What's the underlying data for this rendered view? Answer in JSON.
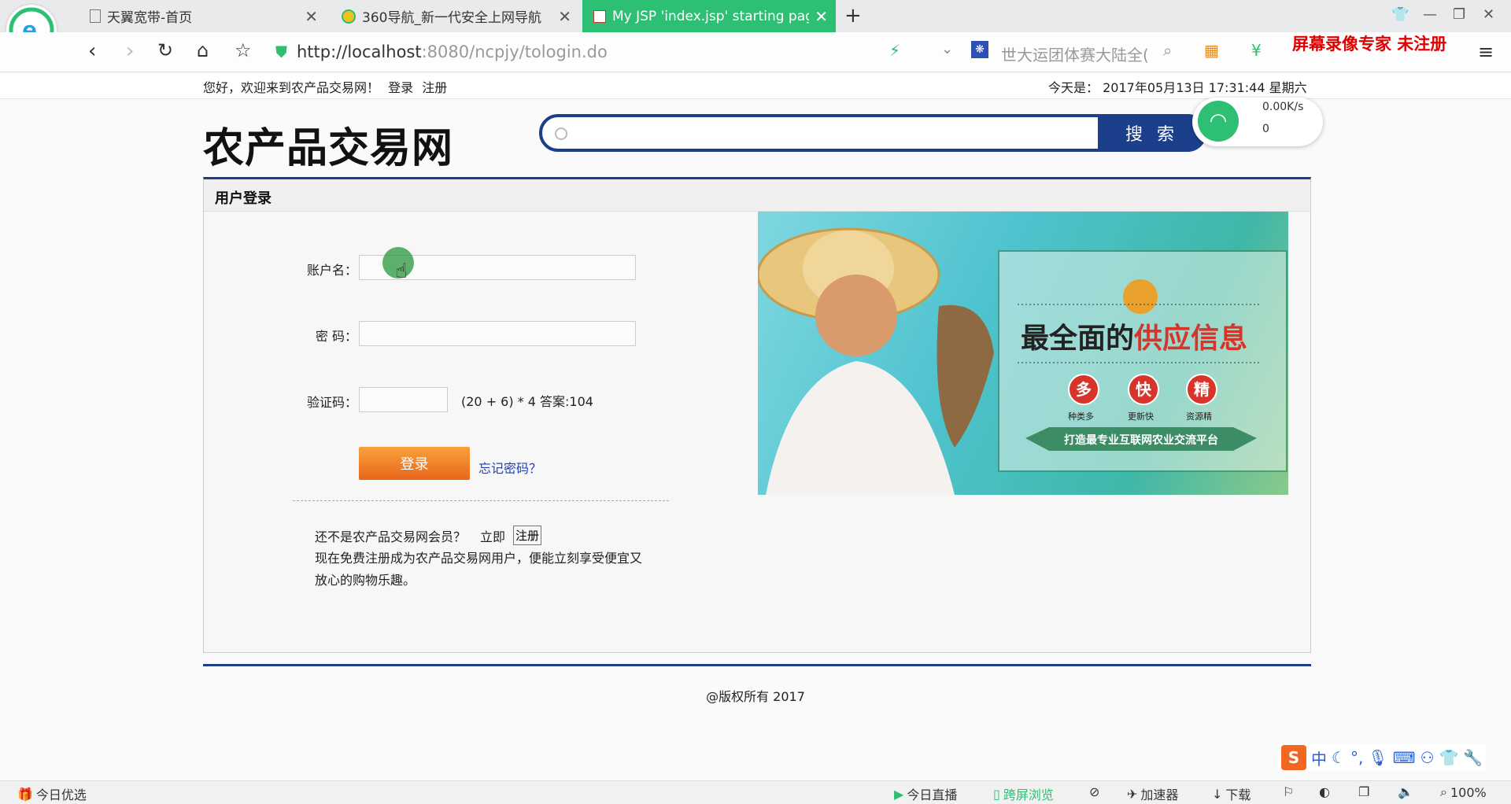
{
  "browser": {
    "tabs": [
      {
        "title": "天翼宽带-首页",
        "active": false
      },
      {
        "title": "360导航_新一代安全上网导航",
        "active": false
      },
      {
        "title": "My JSP 'index.jsp' starting pag",
        "active": true
      }
    ],
    "new_tab": "+",
    "url_host": "http://localhost",
    "url_path": ":8080/ncpjy/tologin.do",
    "search_placeholder": "世大运团体赛大陆全(",
    "watermark": "屏幕录像专家  未注册",
    "colors": {
      "active_tab": "#2dbf74",
      "brand_blue": "#1c3f8c"
    },
    "icons": [
      "back-icon",
      "forward-icon",
      "reload-icon",
      "home-icon",
      "star-icon",
      "shield-icon",
      "lightning-icon",
      "paw-icon",
      "search-icon",
      "apps-icon",
      "menu-icon"
    ]
  },
  "net_widget": {
    "speed": "0.00K/s",
    "count": "0"
  },
  "site": {
    "welcome": "您好，欢迎来到农产品交易网！",
    "login_link": "登录",
    "register_link": "注册",
    "date_label": "今天是：",
    "date_value": "2017年05月13日 17:31:44 星期六",
    "logo": "农产品交易网",
    "search_button": "搜 索"
  },
  "login": {
    "panel_title": "用户登录",
    "username_label": "账户名：",
    "password_label": "密 码：",
    "captcha_label": "验证码：",
    "captcha_question": "(20 + 6) * 4 答案:104",
    "login_button": "登录",
    "forgot_link": "忘记密码？",
    "not_member": "还不是农产品交易网会员？",
    "now": "立即",
    "register_button": "注册",
    "register_desc": "现在免费注册成为农产品交易网用户，便能立刻享受便宜又放心的购物乐趣。"
  },
  "banner": {
    "headline_a": "最全面的",
    "headline_b": "供应信息",
    "badges": [
      {
        "char": "多",
        "caption": "种类多"
      },
      {
        "char": "快",
        "caption": "更新快"
      },
      {
        "char": "精",
        "caption": "资源精"
      }
    ],
    "ribbon": "打造最专业互联网农业交流平台"
  },
  "footer": {
    "copyright": "@版权所有 2017"
  },
  "ime": {
    "lang": "中"
  },
  "statusbar": {
    "left": "今日优选",
    "live": "今日直播",
    "cross_screen": "跨屏浏览",
    "accelerator": "加速器",
    "download": "下载",
    "zoom": "100%"
  }
}
